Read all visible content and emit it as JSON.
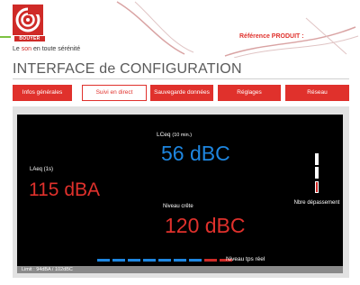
{
  "header": {
    "brand": "BOUYER",
    "tagline_prefix": "Le ",
    "tagline_highlight": "son",
    "tagline_suffix": " en toute sérénité",
    "reference": "Référence  PRODUIT :",
    "accent_color": "#e0312c",
    "logo_icon": "bouyer-spiral-logo"
  },
  "page_title": "INTERFACE de CONFIGURATION",
  "tabs": [
    {
      "label": "Infos générales",
      "active": false
    },
    {
      "label": "Suivi en direct",
      "active": true
    },
    {
      "label": "Sauvegarde données",
      "active": false
    },
    {
      "label": "Réglages",
      "active": false
    },
    {
      "label": "Réseau",
      "active": false
    }
  ],
  "monitor": {
    "laeq_label": "LAeq (1s)",
    "laeq_value": "115 dBA",
    "lceq_label": "LCeq",
    "lceq_period": "(10 min.)",
    "lceq_value": "56 dBC",
    "crete_label": "Niveau crête",
    "crete_value": "120 dBC",
    "depassement_label": "Nbre dépassement",
    "depassement_indicators": [
      "white",
      "white",
      "red"
    ],
    "niveau_label": "Niveau tps réel",
    "level_bars": [
      "blue",
      "blue",
      "blue",
      "blue",
      "blue",
      "blue",
      "blue",
      "red",
      "red"
    ],
    "limit_text": "Limit : 94dBA / 102dBC",
    "colors": {
      "laeq": "#e0312c",
      "lceq": "#1e86e0",
      "crete": "#e0312c",
      "bar_blue": "#1e86e0",
      "bar_red": "#cf2a27"
    }
  }
}
